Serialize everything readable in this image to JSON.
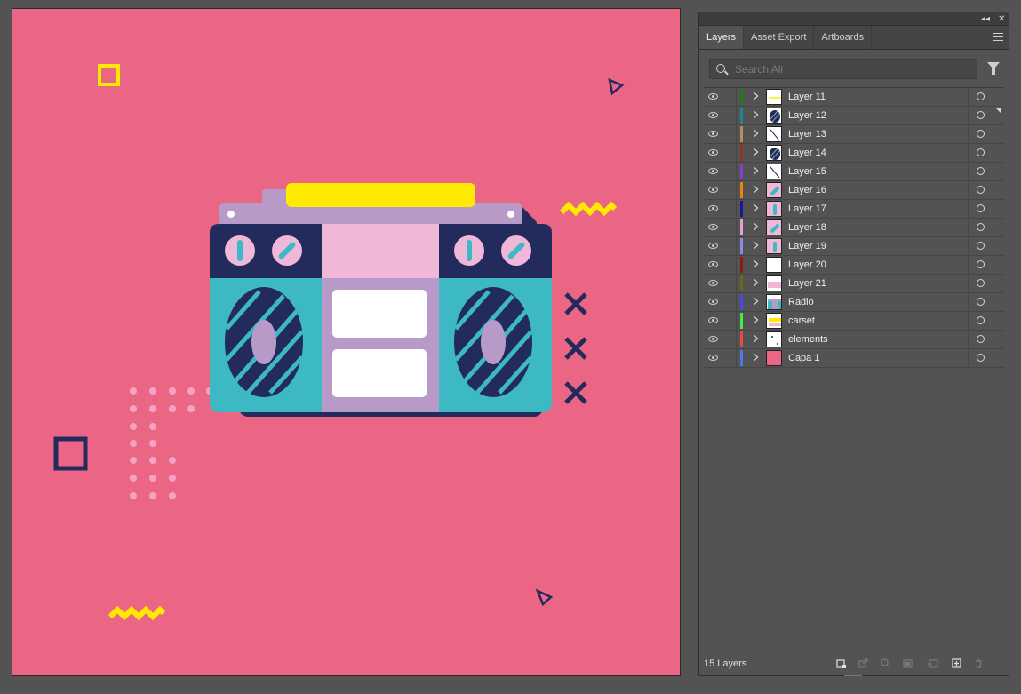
{
  "panel": {
    "tabs": [
      {
        "label": "Layers",
        "active": true
      },
      {
        "label": "Asset Export",
        "active": false
      },
      {
        "label": "Artboards",
        "active": false
      }
    ],
    "search_placeholder": "Search All",
    "layers": [
      {
        "name": "Layer 11",
        "color": "#1f7a1f",
        "thumb": "yellow-line"
      },
      {
        "name": "Layer 12",
        "color": "#1c8a8a",
        "thumb": "speaker"
      },
      {
        "name": "Layer 13",
        "color": "#c08a5a",
        "thumb": "diagonal"
      },
      {
        "name": "Layer 14",
        "color": "#8a3a1a",
        "thumb": "speaker"
      },
      {
        "name": "Layer 15",
        "color": "#8a3ad6",
        "thumb": "diagonal"
      },
      {
        "name": "Layer 16",
        "color": "#e8860a",
        "thumb": "knob-diag"
      },
      {
        "name": "Layer 17",
        "color": "#1a1a8a",
        "thumb": "knob-vert"
      },
      {
        "name": "Layer 18",
        "color": "#e8a0c8",
        "thumb": "knob-diag"
      },
      {
        "name": "Layer 19",
        "color": "#8a8ae8",
        "thumb": "knob-vert"
      },
      {
        "name": "Layer 20",
        "color": "#8a1a1a",
        "thumb": "blank"
      },
      {
        "name": "Layer 21",
        "color": "#6a6a1a",
        "thumb": "pink-bar"
      },
      {
        "name": "Radio",
        "color": "#4a4ae8",
        "thumb": "radio"
      },
      {
        "name": "carset",
        "color": "#4ae84a",
        "thumb": "carset"
      },
      {
        "name": "elements",
        "color": "#e84a4a",
        "thumb": "elements"
      },
      {
        "name": "Capa 1",
        "color": "#4a7ae8",
        "thumb": "pink-fill"
      }
    ],
    "layer_count_label": "15 Layers"
  },
  "colors": {
    "artboard": "#eb6685",
    "navy": "#232a5c",
    "teal": "#3cb9c2",
    "lavender": "#b79ac8",
    "light_pink": "#efb8d8",
    "yellow": "#ffea00",
    "dots": "#f5a3c4"
  }
}
